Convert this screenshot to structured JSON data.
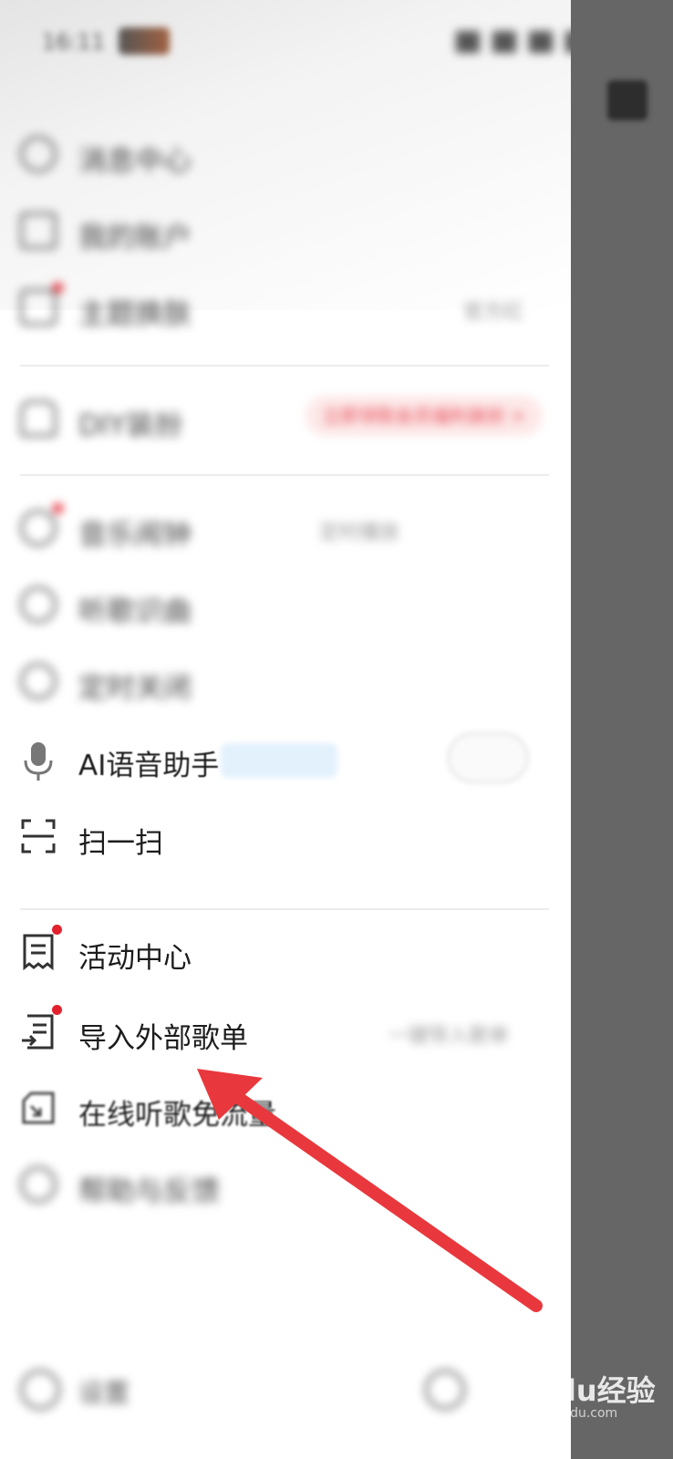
{
  "status_bar": {
    "time": "16:11"
  },
  "menu_blurred_top": [
    {
      "name": "message-center",
      "label": "消息中心",
      "icon": "message-icon"
    },
    {
      "name": "my-account",
      "label": "我的账户",
      "icon": "wallet-icon"
    },
    {
      "name": "theme-skin",
      "label": "主题换肤",
      "icon": "shirt-icon",
      "right": "官方红"
    }
  ],
  "vip_row": {
    "label": "DIY装扮",
    "badge": "立即领取会员福利装扮 >"
  },
  "menu_blurred_mid": [
    {
      "name": "alarm",
      "label": "音乐闹钟",
      "right": "定时播放",
      "icon": "clock-icon"
    },
    {
      "name": "earphone",
      "label": "听歌识曲",
      "icon": "earphone-icon"
    },
    {
      "name": "timer",
      "label": "定时关闭",
      "icon": "timer-icon"
    }
  ],
  "ai_assistant": {
    "label": "AI语音助手",
    "badge": "",
    "icon": "microphone-icon"
  },
  "scan": {
    "label": "扫一扫",
    "icon": "scan-icon"
  },
  "activity_center": {
    "label": "活动中心",
    "icon": "receipt-icon"
  },
  "import_playlist": {
    "label": "导入外部歌单",
    "icon": "import-list-icon",
    "right": "一键导入歌单"
  },
  "online_listening": {
    "label": "在线听歌免流量",
    "icon": "sim-card-icon"
  },
  "blurred_bottom": {
    "label": "帮助与反馈"
  },
  "settings": {
    "label": "设置"
  },
  "watermark": {
    "main": "Baidu经验",
    "sub": "jingyan.baidu.com"
  },
  "colors": {
    "accent_red": "#e3212d",
    "arrow_red": "#e8383d",
    "overlay": "#666666"
  }
}
